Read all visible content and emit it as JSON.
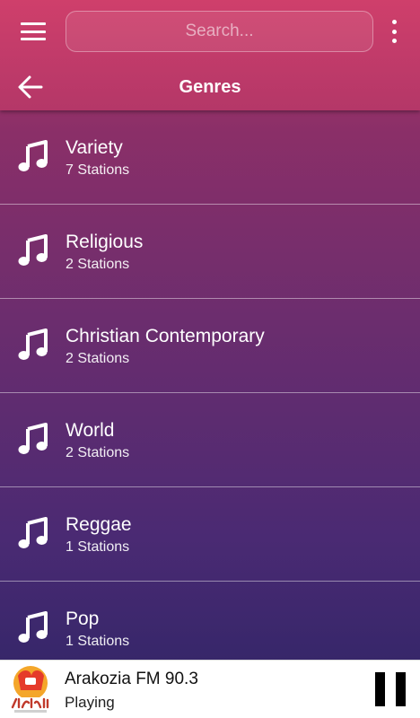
{
  "header": {
    "search_placeholder": "Search...",
    "title": "Genres",
    "icons": {
      "menu": "hamburger-menu-icon",
      "more": "vertical-dots-icon",
      "back": "back-arrow-icon"
    }
  },
  "genres": [
    {
      "name": "Variety",
      "count": "7 Stations"
    },
    {
      "name": "Religious",
      "count": "2 Stations"
    },
    {
      "name": "Christian Contemporary",
      "count": "2 Stations"
    },
    {
      "name": "World",
      "count": "2 Stations"
    },
    {
      "name": "Reggae",
      "count": "1 Stations"
    },
    {
      "name": "Pop",
      "count": "1 Stations"
    }
  ],
  "player": {
    "station": "Arakozia FM 90.3",
    "status": "Playing",
    "logo_icon": "arakozia-logo",
    "control_icon": "pause-icon"
  },
  "colors": {
    "header": "#c43b69",
    "gradient_top": "#b83a67",
    "gradient_bottom": "#2e2566",
    "player_bg": "#ffffff"
  }
}
